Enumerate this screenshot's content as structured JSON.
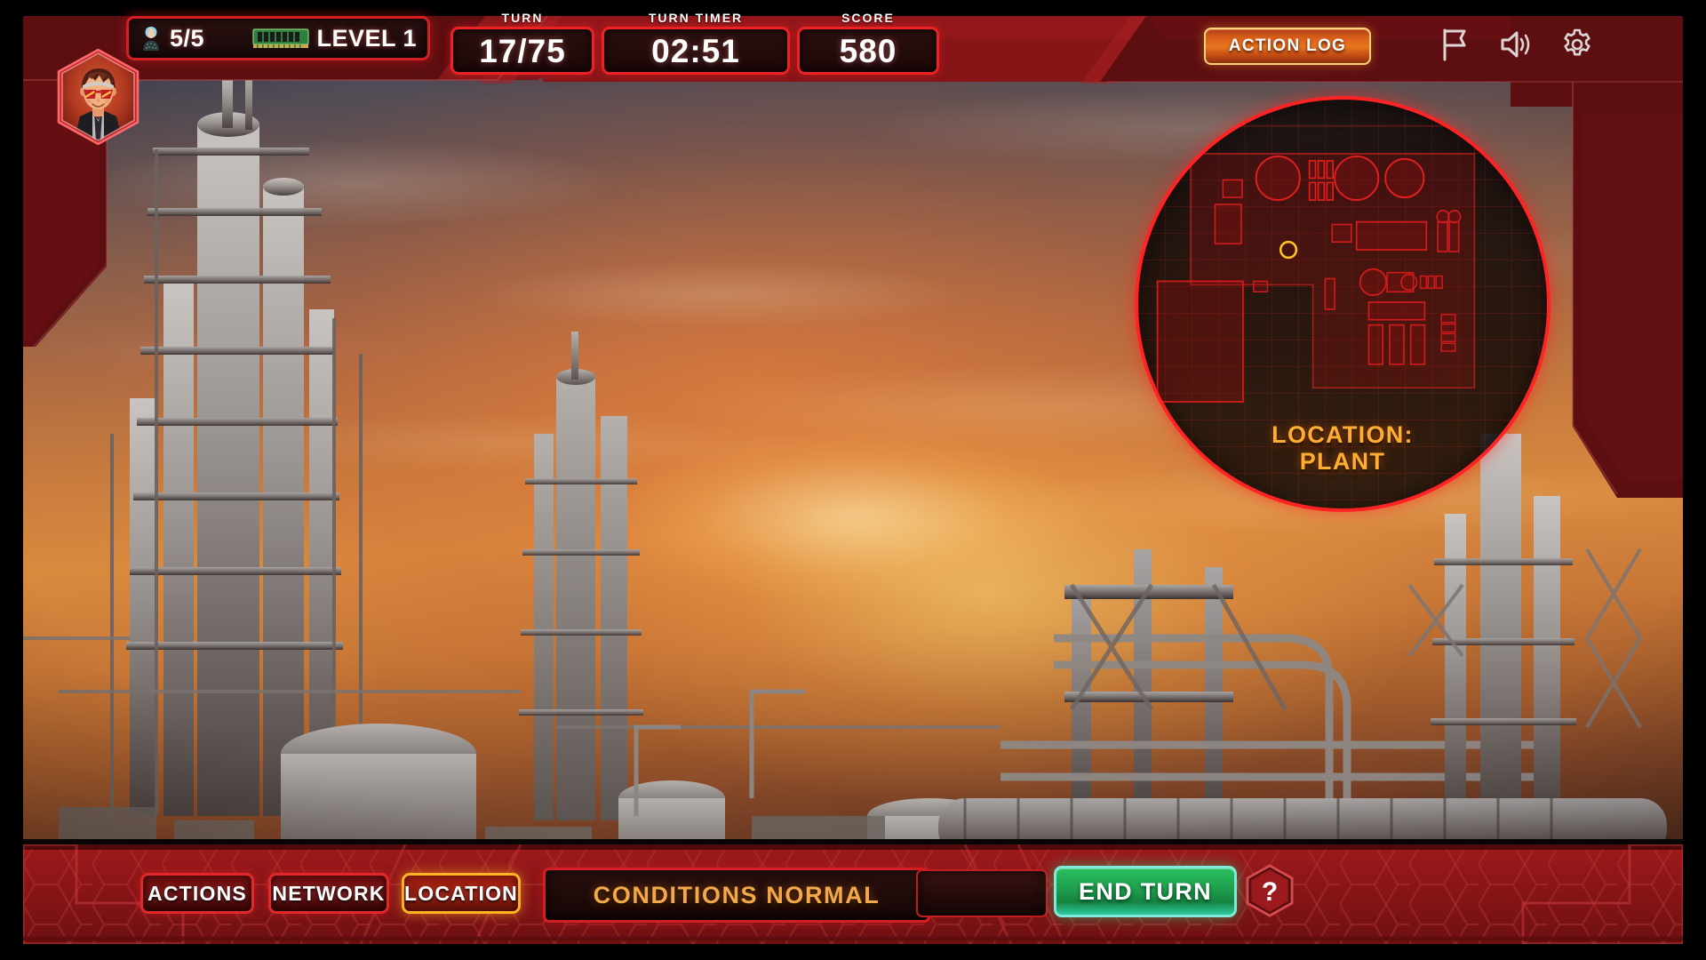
{
  "hud": {
    "agents": {
      "icon": "agent-icon",
      "value": "5/5"
    },
    "memory": {
      "icon": "ram-chip-icon",
      "value": "LEVEL 1"
    },
    "readouts": [
      {
        "label": "TURN",
        "value": "17/75",
        "name": "turn"
      },
      {
        "label": "TURN TIMER",
        "value": "02:51",
        "name": "turn-timer"
      },
      {
        "label": "SCORE",
        "value": "580",
        "name": "score"
      }
    ],
    "action_log_label": "ACTION LOG",
    "icons": [
      {
        "name": "flag-icon",
        "label": "flag"
      },
      {
        "name": "sound-icon",
        "label": "sound"
      },
      {
        "name": "gear-icon",
        "label": "settings"
      }
    ],
    "avatar": {
      "name": "player-avatar",
      "alt": "Agent portrait with red visor glasses"
    }
  },
  "radar": {
    "caption_line1": "LOCATION:",
    "caption_line2": "PLANT",
    "marker": {
      "name": "objective-marker",
      "color": "#ffc21e"
    }
  },
  "bottom": {
    "tabs": [
      {
        "label": "ACTIONS",
        "active": false,
        "name": "tab-actions"
      },
      {
        "label": "NETWORK",
        "active": false,
        "name": "tab-network"
      },
      {
        "label": "LOCATION",
        "active": true,
        "name": "tab-location"
      }
    ],
    "status_text": "CONDITIONS NORMAL",
    "end_turn_label": "END TURN",
    "help_label": "?"
  },
  "colors": {
    "accent_red": "#d61f22",
    "bright_red": "#ff2323",
    "frame_dark_red": "#5a0d10",
    "amber": "#ffae33",
    "orange_button": "#e8751f",
    "green_confirm": "#28c060",
    "panel_dark": "#200c0c",
    "text_white": "#ffffff"
  }
}
